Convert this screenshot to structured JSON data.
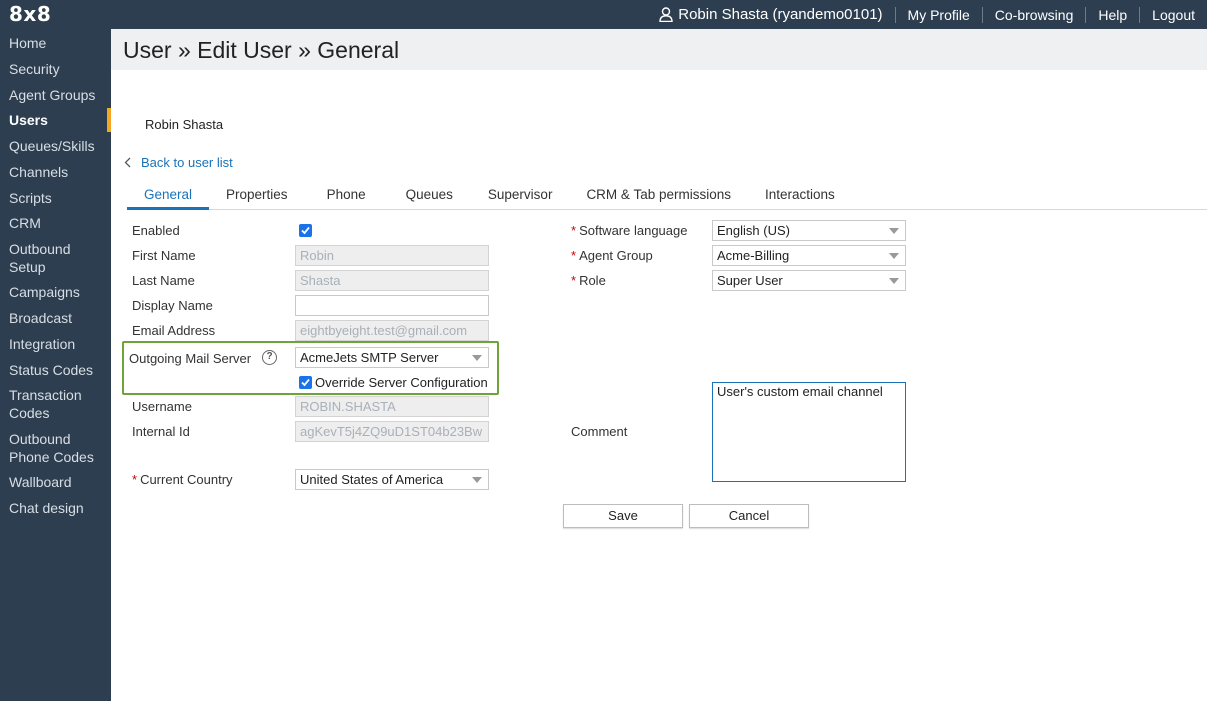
{
  "topbar": {
    "logo": "8x8",
    "user": "Robin Shasta (ryandemo0101)",
    "links": [
      "My Profile",
      "Co-browsing",
      "Help",
      "Logout"
    ]
  },
  "sidebar": {
    "items": [
      {
        "label": "Home"
      },
      {
        "label": "Security"
      },
      {
        "label": "Agent Groups"
      },
      {
        "label": "Users",
        "active": true
      },
      {
        "label": "Queues/Skills"
      },
      {
        "label": "Channels"
      },
      {
        "label": "Scripts"
      },
      {
        "label": "CRM"
      },
      {
        "label": "Outbound Setup"
      },
      {
        "label": "Campaigns"
      },
      {
        "label": "Broadcast"
      },
      {
        "label": "Integration"
      },
      {
        "label": "Status Codes"
      },
      {
        "label": "Transaction Codes"
      },
      {
        "label": "Outbound Phone Codes"
      },
      {
        "label": "Wallboard"
      },
      {
        "label": "Chat design"
      }
    ]
  },
  "page": {
    "title": "User » Edit User » General",
    "user_name": "Robin Shasta",
    "back_link": "Back to user list"
  },
  "tabs": [
    "General",
    "Properties",
    "Phone",
    "Queues",
    "Supervisor",
    "CRM & Tab permissions",
    "Interactions"
  ],
  "form": {
    "enabled_label": "Enabled",
    "enabled": true,
    "first_name_label": "First Name",
    "first_name": "Robin",
    "last_name_label": "Last Name",
    "last_name": "Shasta",
    "display_name_label": "Display Name",
    "display_name": "",
    "email_label": "Email Address",
    "email": "eightbyeight.test@gmail.com",
    "mail_server_label": "Outgoing Mail Server",
    "mail_server": "AcmeJets SMTP Server",
    "override_label": "Override Server Configuration",
    "override": true,
    "username_label": "Username",
    "username": "ROBIN.SHASTA",
    "internal_id_label": "Internal Id",
    "internal_id": "agKevT5j4ZQ9uD1ST04b23Bw",
    "country_label": "Current Country",
    "country": "United States of America",
    "software_language_label": "Software language",
    "software_language": "English (US)",
    "agent_group_label": "Agent Group",
    "agent_group": "Acme-Billing",
    "role_label": "Role",
    "role": "Super User",
    "comment_label": "Comment",
    "comment": "User's custom email channel",
    "required_mark": "*",
    "help_glyph": "?"
  },
  "buttons": {
    "save": "Save",
    "cancel": "Cancel"
  },
  "colors": {
    "nav_bg": "#2d3e50",
    "accent": "#1a73b8",
    "active_marker": "#f5a623",
    "highlight": "#6fa33a"
  }
}
